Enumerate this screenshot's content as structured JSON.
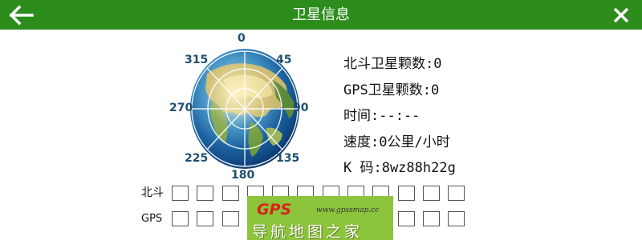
{
  "header": {
    "title": "卫星信息",
    "back_icon": "back-arrow-icon",
    "close_icon": "close-x-icon",
    "background_color": "#2c8c1c"
  },
  "compass": {
    "degrees": {
      "n": "0",
      "ne": "45",
      "e": "90",
      "se": "135",
      "s": "180",
      "sw": "225",
      "w": "270",
      "nw": "315"
    }
  },
  "info": {
    "beidou_count": "北斗卫星颗数:0",
    "gps_count": "GPS卫星颗数:0",
    "time": "时间:--:--",
    "speed": "速度:0公里/小时",
    "k_code": "K 码:8wz88h22g"
  },
  "satellites": {
    "beidou_label": "北斗",
    "gps_label": "GPS",
    "beidou_slots": 12,
    "gps_slots": 12
  },
  "watermark": {
    "logo": "GPS",
    "url": "www.gpssmap.cc",
    "name": "导航地图之家"
  }
}
